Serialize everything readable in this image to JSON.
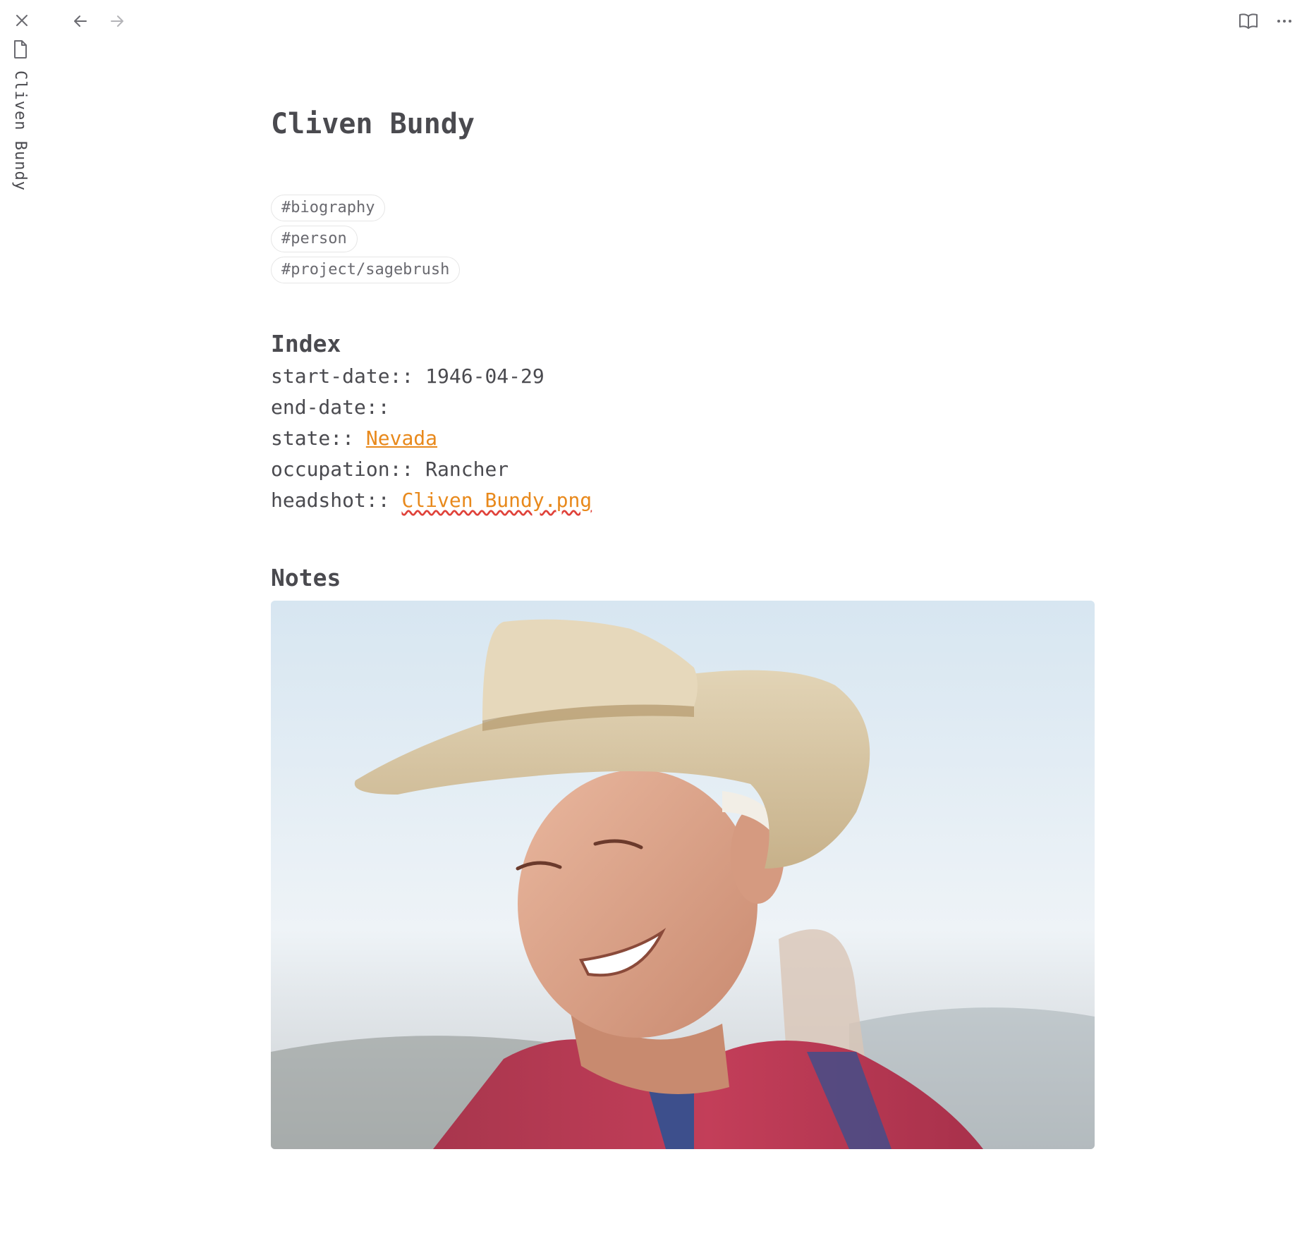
{
  "sidebar": {
    "tab_title": "Cliven Bundy"
  },
  "note": {
    "title": "Cliven Bundy",
    "tags": [
      "#biography",
      "#person",
      "#project/sagebrush"
    ],
    "index_heading": "Index",
    "properties": [
      {
        "key": "start-date::",
        "value": "1946-04-29"
      },
      {
        "key": "end-date::",
        "value": ""
      },
      {
        "key": "state::",
        "value": "Nevada",
        "link": true
      },
      {
        "key": "occupation::",
        "value": "Rancher"
      },
      {
        "key": "headshot::",
        "value": "Cliven Bundy.png",
        "link": true
      }
    ],
    "notes_heading": "Notes"
  },
  "colors": {
    "text": "#4a4a4f",
    "link": "#e8891c",
    "spellcheck_underline": "#e0423a",
    "tag_border": "#e6e6e6"
  },
  "icons": [
    "close-icon",
    "file-icon",
    "arrow-left-icon",
    "arrow-right-icon",
    "book-open-icon",
    "more-horizontal-icon"
  ]
}
